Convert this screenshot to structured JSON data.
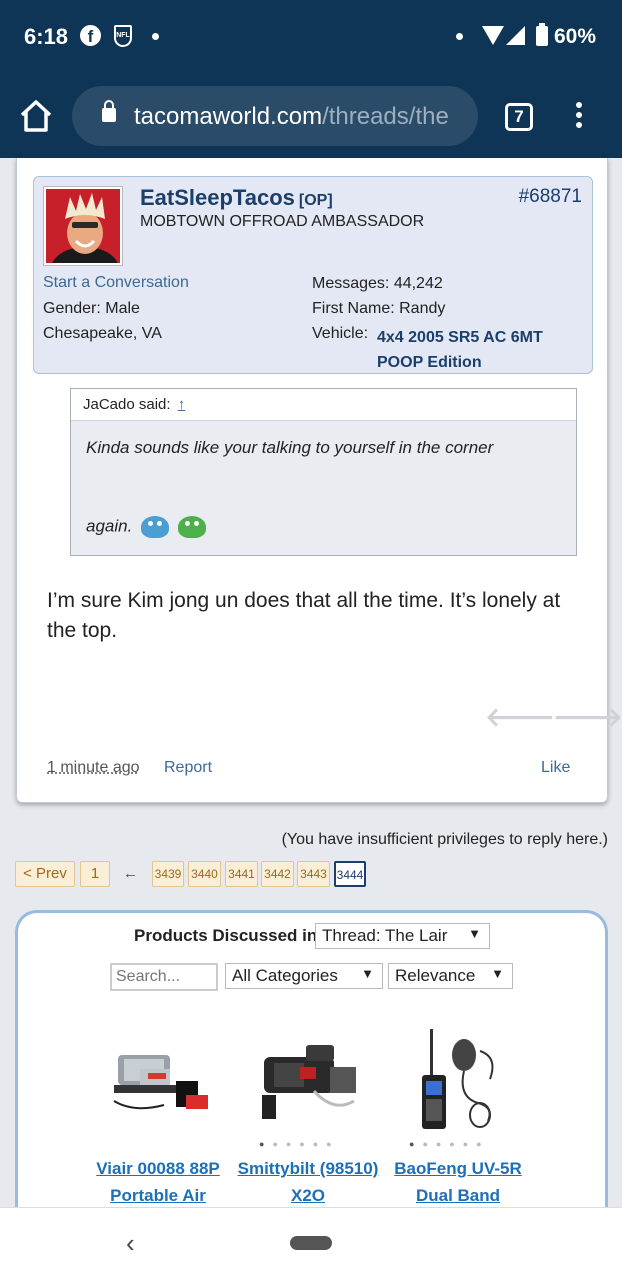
{
  "status_bar": {
    "time": "6:18",
    "battery": "60%",
    "icons": [
      "facebook-icon",
      "nfl-icon",
      "wifi-icon",
      "cell-signal-icon",
      "battery-icon"
    ]
  },
  "browser": {
    "url_host": "tacomaworld.com",
    "url_path": "/threads/the",
    "tab_count": "7"
  },
  "post": {
    "username": "EatSleepTacos",
    "op_tag": "[OP]",
    "user_title": "MOBTOWN OFFROAD AMBASSADOR",
    "post_number": "#68871",
    "start_conversation": "Start a Conversation",
    "gender": "Gender:  Male",
    "location": "Chesapeake, VA",
    "messages": "Messages:  44,242",
    "first_name": "First Name:  Randy",
    "vehicle_label": "Vehicle:",
    "vehicle_value": "4x4 2005 SR5 AC 6MT POOP Edition",
    "quote": {
      "author": "JaCado said:",
      "arrow": "↑",
      "text_line1": "Kinda sounds like your talking to yourself in the corner",
      "text_line2": "again."
    },
    "message": "I’m sure Kim jong un does that all the time. It’s lonely at the top.",
    "timestamp": "1 minute ago",
    "report": "Report",
    "like": "Like"
  },
  "privileges_note": "(You have insufficient privileges to reply here.)",
  "pagination": {
    "prev": "< Prev",
    "first": "1",
    "ellipsis": "←",
    "pages": [
      "3439",
      "3440",
      "3441",
      "3442",
      "3443"
    ],
    "current": "3444"
  },
  "products": {
    "title": "Products Discussed in",
    "thread_select": "Thread: The Lair",
    "search_placeholder": "Search...",
    "category_select": "All Categories",
    "sort_select": "Relevance",
    "items": [
      {
        "name": "Viair 00088 88P Portable Air"
      },
      {
        "name": "Smittybilt (98510) X2O"
      },
      {
        "name": "BaoFeng UV-5R Dual Band"
      }
    ]
  },
  "colors": {
    "header_bg": "#0f3556",
    "link_blue": "#1b3f6a",
    "page_btn_bg": "#fbeed6"
  }
}
